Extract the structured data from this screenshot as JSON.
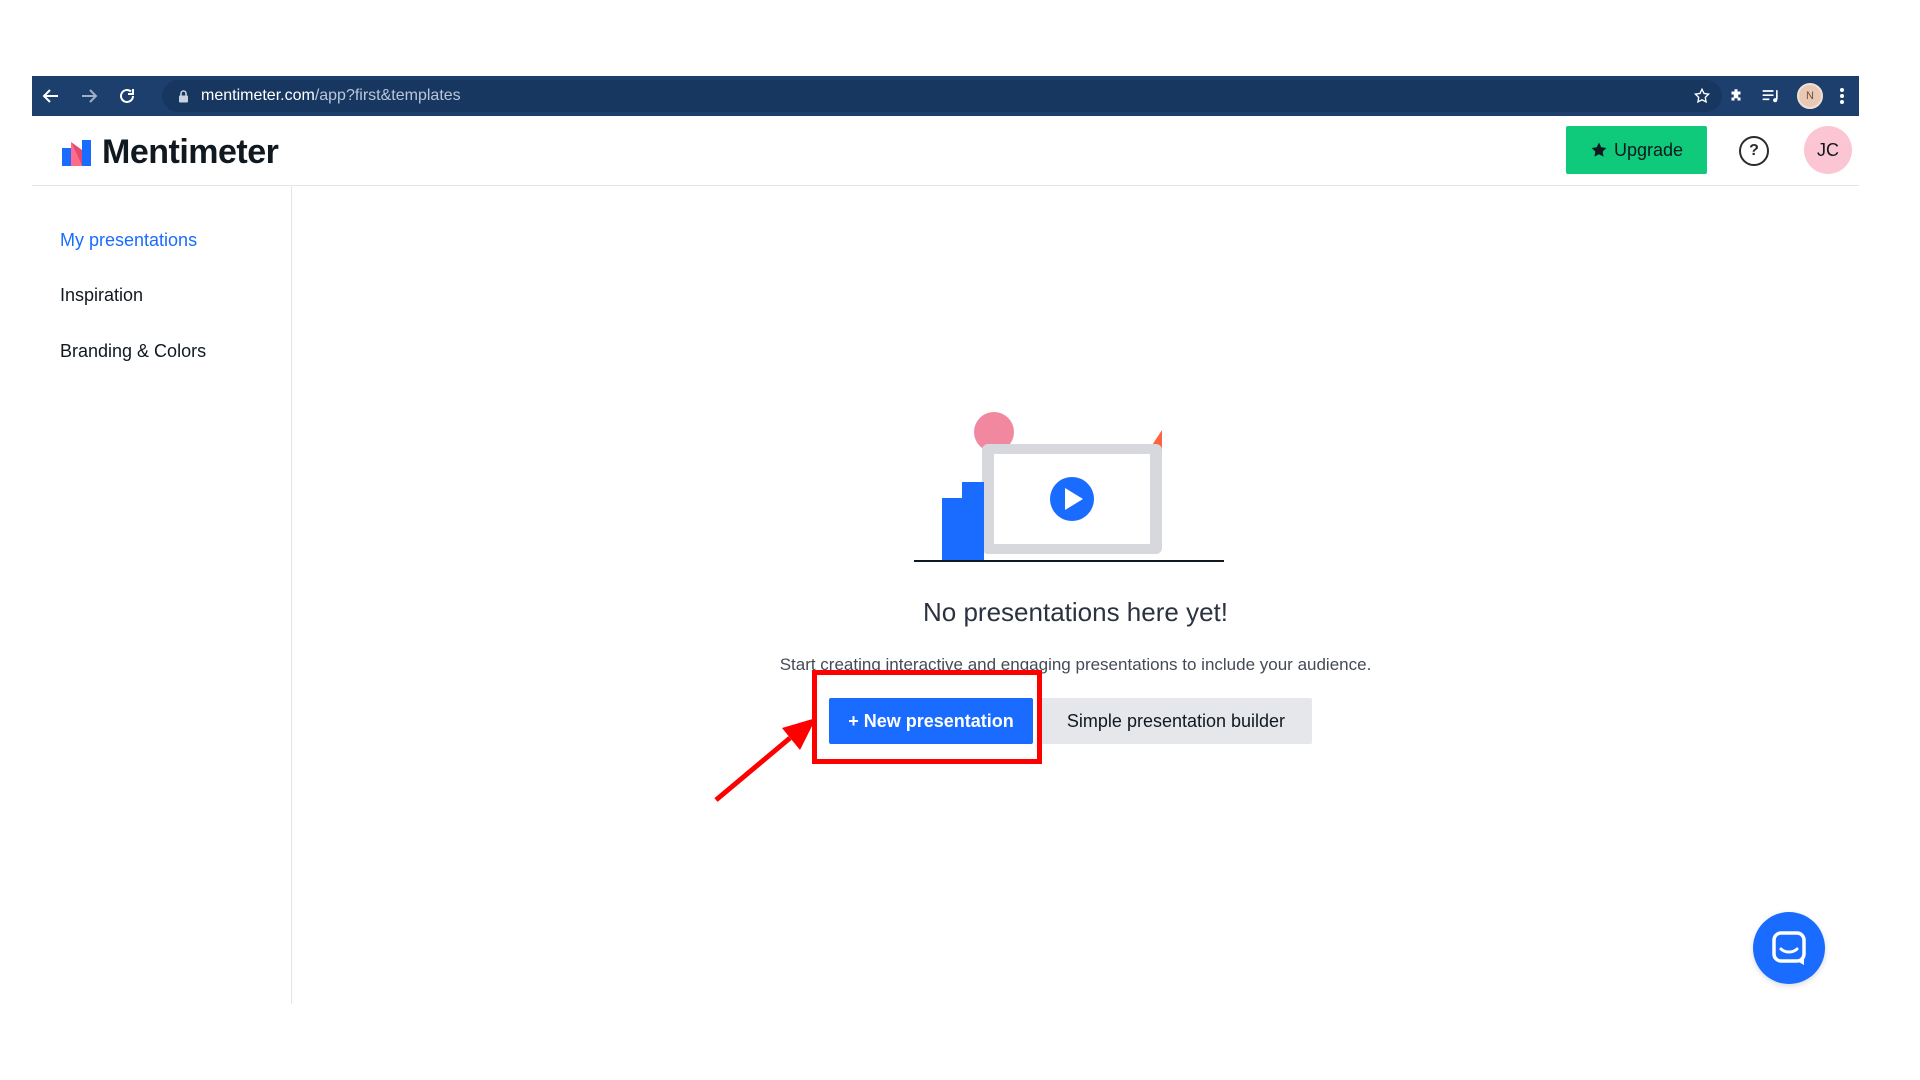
{
  "browser": {
    "url_domain": "mentimeter.com",
    "url_path": "/app?first&templates",
    "icons": [
      "back-icon",
      "forward-icon",
      "reload-icon",
      "lock-icon",
      "star-icon",
      "extensions-icon",
      "reading-list-icon",
      "profile-icon",
      "menu-icon"
    ]
  },
  "header": {
    "logo_text": "Mentimeter",
    "upgrade_label": "Upgrade",
    "help_icon": "help-icon",
    "avatar_initials": "JC"
  },
  "sidebar": {
    "items": [
      {
        "label": "My presentations",
        "active": true
      },
      {
        "label": "Inspiration",
        "active": false
      },
      {
        "label": "Branding & Colors",
        "active": false
      }
    ]
  },
  "main": {
    "empty_title": "No presentations here yet!",
    "empty_description": "Start creating interactive and engaging presentations to include your audience.",
    "new_presentation_label": "+ New presentation",
    "simple_builder_label": "Simple presentation builder"
  },
  "colors": {
    "browser_bar": "#1d3f6e",
    "accent_blue": "#196cff",
    "upgrade_green": "#0fca7a",
    "avatar_pink": "#fbc5d3",
    "annotation_red": "#ff0000"
  }
}
